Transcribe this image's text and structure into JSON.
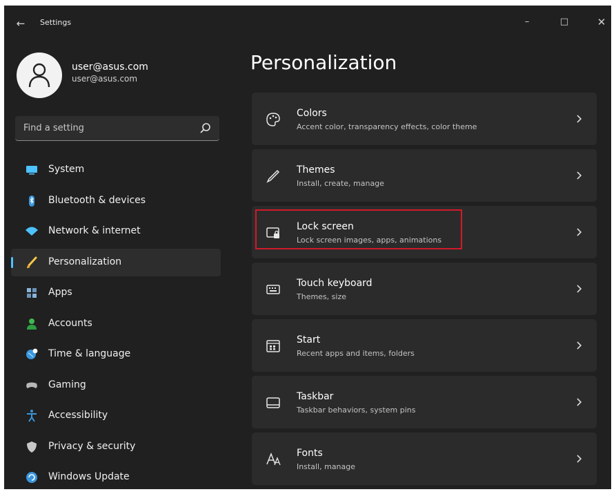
{
  "window": {
    "title": "Settings",
    "back_icon": "back-arrow-icon",
    "controls": {
      "minimize": "–",
      "maximize": "□",
      "close": "✕"
    }
  },
  "user": {
    "name": "user@asus.com",
    "email": "user@asus.com",
    "avatar_icon": "person-icon"
  },
  "search": {
    "placeholder": "Find a setting",
    "icon": "search-icon"
  },
  "sidebar": {
    "items": [
      {
        "label": "System",
        "icon": "system-icon",
        "active": false
      },
      {
        "label": "Bluetooth & devices",
        "icon": "bluetooth-icon",
        "active": false
      },
      {
        "label": "Network & internet",
        "icon": "wifi-icon",
        "active": false
      },
      {
        "label": "Personalization",
        "icon": "brush-icon",
        "active": true
      },
      {
        "label": "Apps",
        "icon": "apps-icon",
        "active": false
      },
      {
        "label": "Accounts",
        "icon": "accounts-icon",
        "active": false
      },
      {
        "label": "Time & language",
        "icon": "globe-icon",
        "active": false
      },
      {
        "label": "Gaming",
        "icon": "gamepad-icon",
        "active": false
      },
      {
        "label": "Accessibility",
        "icon": "accessibility-icon",
        "active": false
      },
      {
        "label": "Privacy & security",
        "icon": "shield-icon",
        "active": false
      },
      {
        "label": "Windows Update",
        "icon": "update-icon",
        "active": false
      }
    ]
  },
  "main": {
    "title": "Personalization",
    "cards": [
      {
        "title": "Colors",
        "subtitle": "Accent color, transparency effects, color theme",
        "icon": "palette-icon"
      },
      {
        "title": "Themes",
        "subtitle": "Install, create, manage",
        "icon": "pen-icon"
      },
      {
        "title": "Lock screen",
        "subtitle": "Lock screen images, apps, animations",
        "icon": "lock-screen-icon",
        "highlighted": true
      },
      {
        "title": "Touch keyboard",
        "subtitle": "Themes, size",
        "icon": "keyboard-icon"
      },
      {
        "title": "Start",
        "subtitle": "Recent apps and items, folders",
        "icon": "start-icon"
      },
      {
        "title": "Taskbar",
        "subtitle": "Taskbar behaviors, system pins",
        "icon": "taskbar-icon"
      },
      {
        "title": "Fonts",
        "subtitle": "Install, manage",
        "icon": "fonts-icon"
      }
    ]
  },
  "colors": {
    "background": "#202020",
    "card": "#2b2b2b",
    "accent": "#4cc2ff",
    "highlight": "#d11a2a"
  }
}
